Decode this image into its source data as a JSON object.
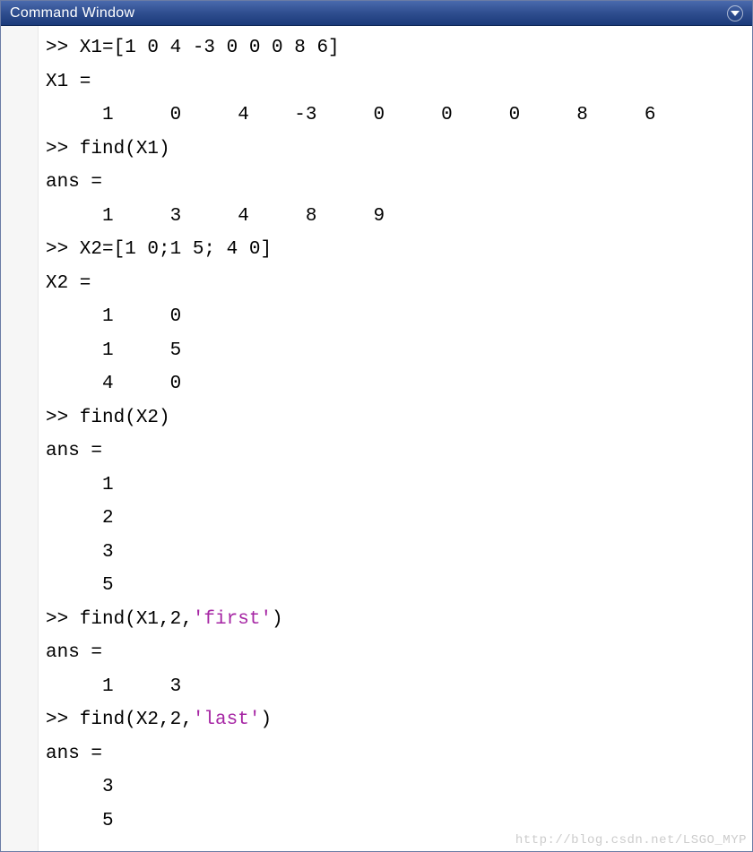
{
  "window": {
    "title": "Command Window"
  },
  "session": {
    "lines": [
      {
        "kind": "cmd",
        "text": ">> X1=[1 0 4 -3 0 0 0 8 6]"
      },
      {
        "kind": "out",
        "text": "X1 ="
      },
      {
        "kind": "out",
        "text": "     1     0     4    -3     0     0     0     8     6"
      },
      {
        "kind": "cmd",
        "text": ">> find(X1)"
      },
      {
        "kind": "out",
        "text": "ans ="
      },
      {
        "kind": "out",
        "text": "     1     3     4     8     9"
      },
      {
        "kind": "cmd",
        "text": ">> X2=[1 0;1 5; 4 0]"
      },
      {
        "kind": "out",
        "text": "X2 ="
      },
      {
        "kind": "out",
        "text": "     1     0"
      },
      {
        "kind": "out",
        "text": "     1     5"
      },
      {
        "kind": "out",
        "text": "     4     0"
      },
      {
        "kind": "cmd",
        "text": ">> find(X2)"
      },
      {
        "kind": "out",
        "text": "ans ="
      },
      {
        "kind": "out",
        "text": "     1"
      },
      {
        "kind": "out",
        "text": "     2"
      },
      {
        "kind": "out",
        "text": "     3"
      },
      {
        "kind": "out",
        "text": "     5"
      },
      {
        "kind": "cmdstr",
        "prefix": ">> find(X1,2,",
        "str": "'first'",
        "suffix": ")"
      },
      {
        "kind": "out",
        "text": "ans ="
      },
      {
        "kind": "out",
        "text": "     1     3"
      },
      {
        "kind": "cmdstr",
        "prefix": ">> find(X2,2,",
        "str": "'last'",
        "suffix": ")"
      },
      {
        "kind": "out",
        "text": "ans ="
      },
      {
        "kind": "out",
        "text": "     3"
      },
      {
        "kind": "out",
        "text": "     5"
      }
    ]
  },
  "watermark": "http://blog.csdn.net/LSGO_MYP"
}
